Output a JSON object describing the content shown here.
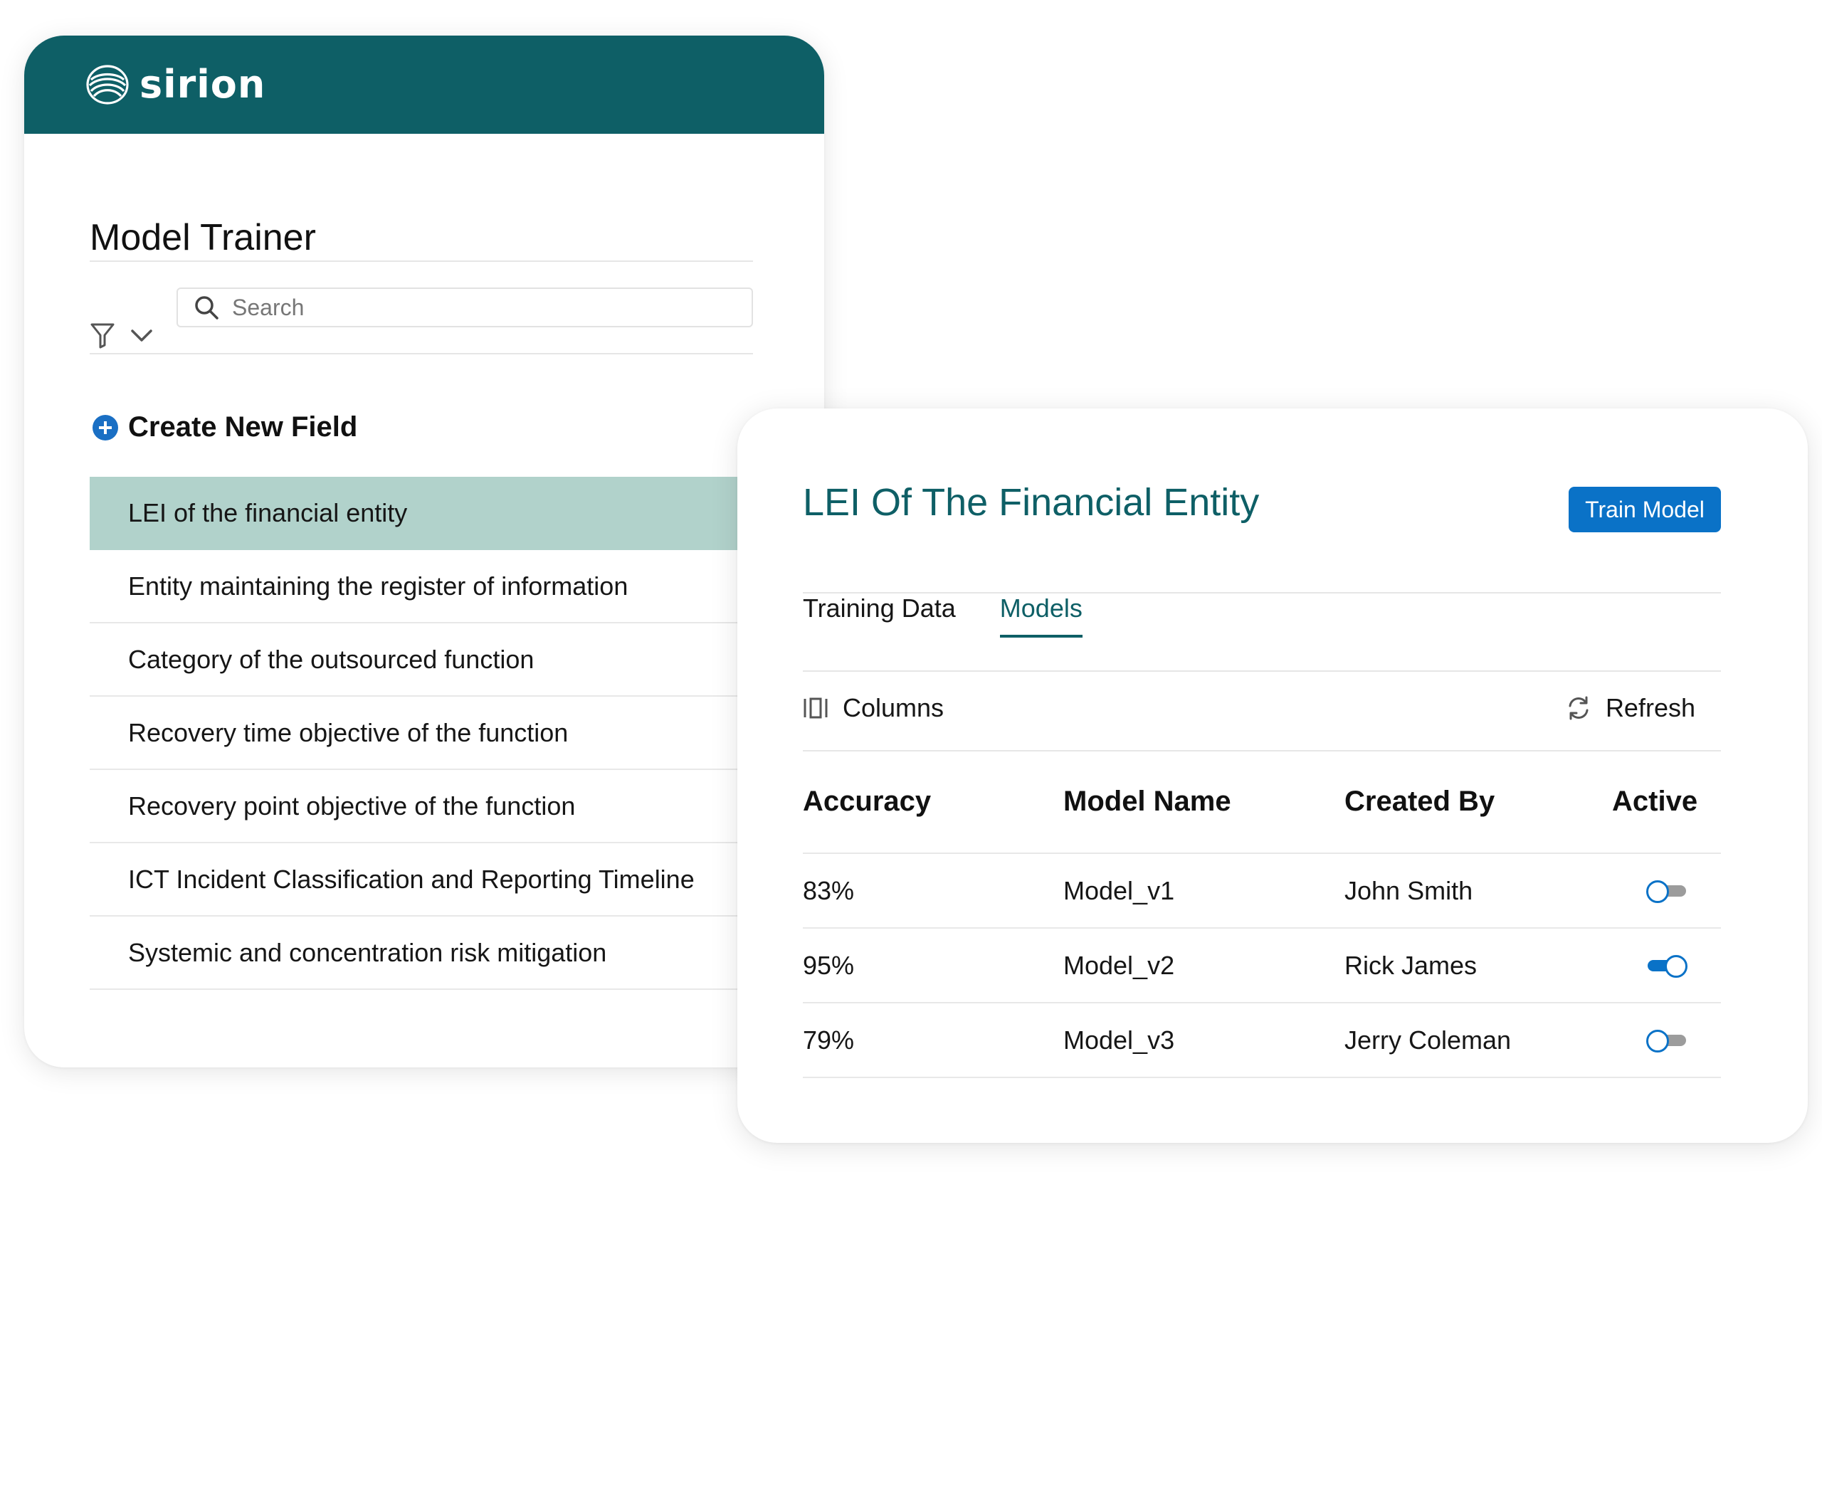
{
  "brand": {
    "logo_text": "sirion",
    "header_color": "#0e5f66"
  },
  "left_panel": {
    "title": "Model Trainer",
    "search": {
      "placeholder": "Search",
      "value": ""
    },
    "create_new_label": "Create New Field",
    "fields": [
      {
        "label": "LEI of the financial entity",
        "selected": true
      },
      {
        "label": "Entity maintaining the register of information",
        "selected": false
      },
      {
        "label": "Category of the outsourced function",
        "selected": false
      },
      {
        "label": "Recovery time objective of the function",
        "selected": false
      },
      {
        "label": "Recovery point objective of the function",
        "selected": false
      },
      {
        "label": "ICT Incident Classification and Reporting Timeline",
        "selected": false
      },
      {
        "label": "Systemic and concentration risk mitigation",
        "selected": false
      }
    ]
  },
  "right_panel": {
    "title": "LEI Of The Financial Entity",
    "train_button_label": "Train Model",
    "tabs": [
      {
        "label": "Training Data",
        "active": false
      },
      {
        "label": "Models",
        "active": true
      }
    ],
    "toolbar": {
      "columns_label": "Columns",
      "refresh_label": "Refresh"
    },
    "table": {
      "headers": [
        "Accuracy",
        "Model Name",
        "Created By",
        "Active"
      ],
      "rows": [
        {
          "accuracy": "83%",
          "model_name": "Model_v1",
          "created_by": "John Smith",
          "active": false
        },
        {
          "accuracy": "95%",
          "model_name": "Model_v2",
          "created_by": "Rick James",
          "active": true
        },
        {
          "accuracy": "79%",
          "model_name": "Model_v3",
          "created_by": "Jerry Coleman",
          "active": false
        }
      ]
    }
  },
  "colors": {
    "teal": "#0e5f66",
    "selected_row": "#b1d2cb",
    "accent_blue": "#0a72c7"
  }
}
